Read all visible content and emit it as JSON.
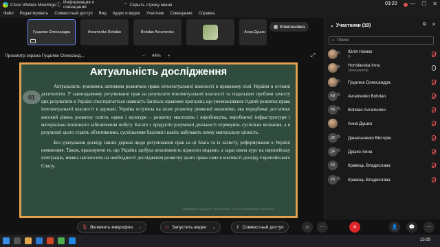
{
  "titlebar": {
    "app_title": "Cisco Webex Meetings",
    "meeting_info": "Информация о совещании",
    "hide_bar": "Скрыть строку меню",
    "time": "03:20"
  },
  "menubar": [
    "Файл",
    "Редактировать",
    "Совместный доступ",
    "Вид",
    "Аудио и видео",
    "Участник",
    "Совещание",
    "Справка"
  ],
  "thumbnails": [
    {
      "name": "Гуцалюк Олександра",
      "type": "self"
    },
    {
      "name": "Avramenko Bohdan",
      "type": "name"
    },
    {
      "name": "Bohdan Avramenko",
      "type": "name"
    },
    {
      "name": "",
      "type": "image"
    },
    {
      "name": "Анна Душко",
      "type": "name"
    }
  ],
  "layout_button": "Компоновка",
  "sharebar": {
    "title": "Просмотр экрана Гуцалюк Олександ...",
    "zoom_minus": "−",
    "zoom_level": "44%",
    "zoom_plus": "+"
  },
  "slide": {
    "number": "01",
    "title": "Актуальність дослідження",
    "paragraphs": [
      "Актуальність зумовлена активним розвитком права інтелектуальної власності в правовому полі України в останні десятиліття. У законодавчому регулюванні прав на результати інтелектуальної власності та подальших проблем захисту цих результатів в Україні спостерігається наявність багатьох правових прогалин, що унеможливлює гідний розвиток права інтелектуальної власності в державі. Україна вступила на шлях розвитку ринкової економіки, яка передбачає достатньо високий рівень розвитку освіти, науки і культури – розвитку мистецтва і виробництва, виробничої інфраструктури і матеріально-технічного забезпечення побуту. Багато з продуктів розумової діяльності отримують суспільне визнання, а в результаті цього стають об'єктивними, суспільними благами і навіть набувають певну матеріальну цінність.",
      "Без урахування досвіду інших держав щодо регулювання прав на ці блага та їх захисту, реформування в Україні неможливе. Також, враховуючи те, що Україна здобула незалежність відносно недавно, а зараз взяла курс на європейську інтеграцію, можна наголосити на необхідності дослідження розвитку цього права саме в контексті досвіду Європейського Союзу."
    ],
    "watermark": "Перейдите в раздел \"Настройки\", чтобы активировать Windows."
  },
  "participants": {
    "header": "Участники (10)",
    "search_placeholder": "Поиск",
    "list": [
      {
        "initials": "",
        "name": "Юлія Нанюк",
        "role": "Я",
        "img": true,
        "mod": true
      },
      {
        "initials": "",
        "name": "Horislavska Inna",
        "role": "Организатор",
        "img": true,
        "mod": true
      },
      {
        "initials": "",
        "name": "Гуцалюк Олександра",
        "role": "",
        "img": true,
        "mod": true
      },
      {
        "initials": "AB",
        "name": "Avramenko Bohdan",
        "role": "",
        "img": false,
        "mod": true
      },
      {
        "initials": "BA",
        "name": "Bohdan Avramenko",
        "role": "",
        "img": false,
        "mod": true
      },
      {
        "initials": "",
        "name": "Анна Душко",
        "role": "",
        "img": true,
        "mod": false
      },
      {
        "initials": "ДВ",
        "name": "Данильченко Вікторія",
        "role": "",
        "img": false,
        "mod": true
      },
      {
        "initials": "ДА",
        "name": "Душко Анна",
        "role": "",
        "img": false,
        "mod": true
      },
      {
        "initials": "КВ",
        "name": "Кравець Владислава",
        "role": "",
        "img": false,
        "mod": false
      },
      {
        "initials": "КВ",
        "name": "Кравець Владислава",
        "role": "",
        "img": false,
        "mod": true
      }
    ]
  },
  "toolbar": {
    "mic_label": "Включить микрофон",
    "video_label": "Запустить видео",
    "share_label": "Совместный доступ"
  },
  "taskbar": {
    "time": "15:09",
    "date": "1.12.2021"
  },
  "colors": {
    "slide_border": "#e0a24e",
    "slide_bg": "#2f4c3f",
    "end_call": "#e0262b"
  }
}
